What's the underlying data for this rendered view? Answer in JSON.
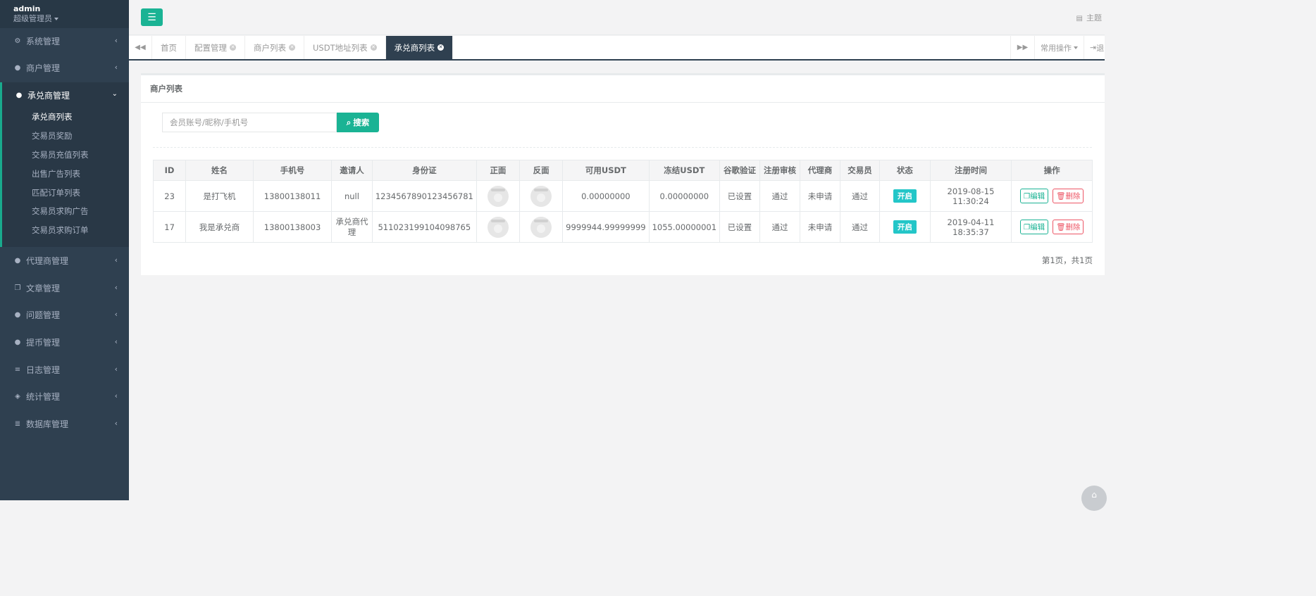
{
  "sidebar": {
    "user": {
      "name": "admin",
      "role": "超级管理员"
    },
    "items_top": [
      {
        "label": "系统管理",
        "icon": "gear-icon",
        "glyph": "⚙"
      },
      {
        "label": "商户管理",
        "icon": "user-icon",
        "glyph": "●"
      }
    ],
    "active_group": {
      "label": "承兑商管理",
      "icon": "user-icon",
      "glyph": "●",
      "subitems": [
        "承兑商列表",
        "交易员奖励",
        "交易员充值列表",
        "出售广告列表",
        "匹配订单列表",
        "交易员求购广告",
        "交易员求购订单"
      ]
    },
    "items_bottom": [
      {
        "label": "代理商管理",
        "icon": "user-icon",
        "glyph": "●"
      },
      {
        "label": "文章管理",
        "icon": "copy-icon",
        "glyph": "❐"
      },
      {
        "label": "问题管理",
        "icon": "comment-icon",
        "glyph": "●"
      },
      {
        "label": "提币管理",
        "icon": "user-icon",
        "glyph": "●"
      },
      {
        "label": "日志管理",
        "icon": "list-icon",
        "glyph": "≡"
      },
      {
        "label": "统计管理",
        "icon": "cube-icon",
        "glyph": "◈"
      },
      {
        "label": "数据库管理",
        "icon": "database-icon",
        "glyph": "≣"
      }
    ]
  },
  "topbar": {
    "theme_label": "主题"
  },
  "tabs": [
    {
      "label": "首页",
      "closable": false
    },
    {
      "label": "配置管理",
      "closable": true
    },
    {
      "label": "商户列表",
      "closable": true
    },
    {
      "label": "USDT地址列表",
      "closable": true
    },
    {
      "label": "承兑商列表",
      "closable": true,
      "active": true
    }
  ],
  "tab_actions": {
    "common_ops": "常用操作",
    "logout": "退出"
  },
  "panel": {
    "title": "商户列表",
    "search": {
      "placeholder": "会员账号/昵称/手机号",
      "button": "搜索"
    },
    "table": {
      "headers": [
        "ID",
        "姓名",
        "手机号",
        "邀请人",
        "身份证",
        "正面",
        "反面",
        "可用USDT",
        "冻结USDT",
        "谷歌验证",
        "注册审核",
        "代理商",
        "交易员",
        "状态",
        "注册时间",
        "操作"
      ],
      "rows": [
        {
          "id": "23",
          "name": "是打飞机",
          "phone": "13800138011",
          "inviter": "null",
          "idcard": "1234567890123456781",
          "usdt": "0.00000000",
          "frozen": "0.00000000",
          "google": "已设置",
          "review": "通过",
          "agent": "未申请",
          "trader": "通过",
          "status": "开启",
          "reg_time": "2019-08-15 11:30:24",
          "edit": "编辑",
          "delete": "删除"
        },
        {
          "id": "17",
          "name": "我是承兑商",
          "phone": "13800138003",
          "inviter": "承兑商代理",
          "idcard": "511023199104098765",
          "usdt": "9999944.99999999",
          "frozen": "1055.00000001",
          "google": "已设置",
          "review": "通过",
          "agent": "未申请",
          "trader": "通过",
          "status": "开启",
          "reg_time": "2019-04-11 18:35:37",
          "edit": "编辑",
          "delete": "删除"
        }
      ]
    },
    "pagination": "第1页，共1页"
  },
  "colors": {
    "sidebar_bg": "#2f4050",
    "accent": "#1ab394",
    "status": "#23c6c8",
    "danger": "#ed5565"
  }
}
